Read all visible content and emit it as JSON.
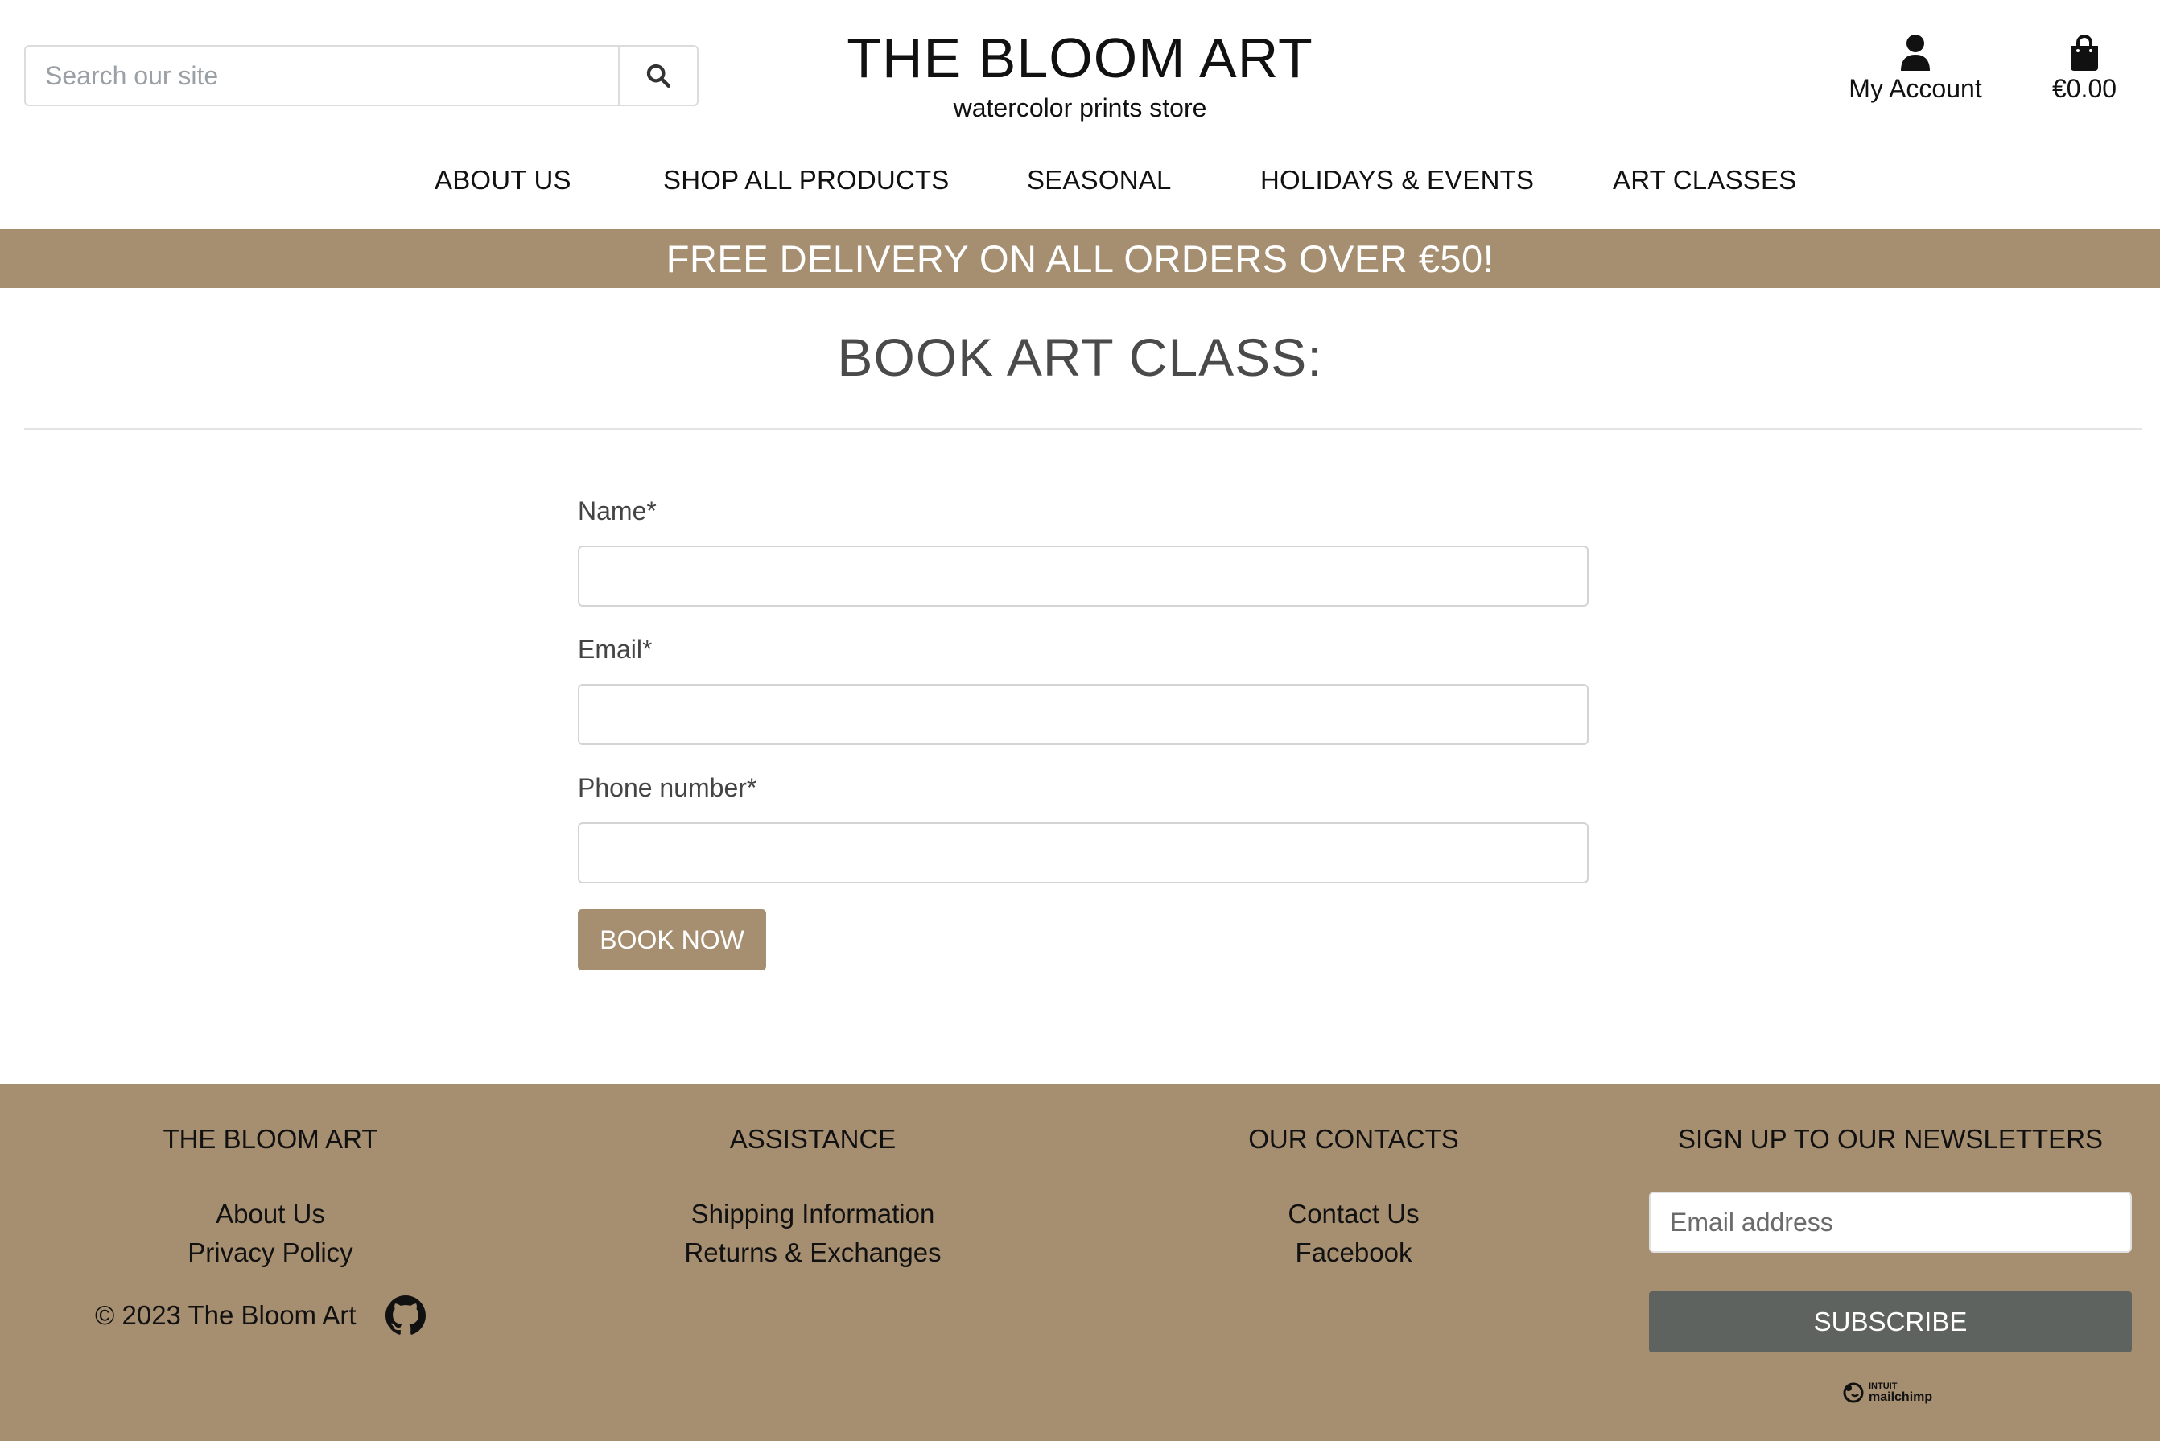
{
  "header": {
    "search_placeholder": "Search our site",
    "brand_title": "THE BLOOM ART",
    "brand_tagline": "watercolor prints store",
    "account_label": "My Account",
    "cart_total": "€0.00"
  },
  "nav": {
    "items": [
      {
        "label": "ABOUT US"
      },
      {
        "label": "SHOP ALL PRODUCTS"
      },
      {
        "label": "SEASONAL"
      },
      {
        "label": "HOLIDAYS & EVENTS"
      },
      {
        "label": "ART CLASSES"
      }
    ]
  },
  "banner": {
    "text": "FREE DELIVERY ON ALL ORDERS OVER €50!"
  },
  "page": {
    "title": "BOOK ART CLASS:"
  },
  "form": {
    "name_label": "Name*",
    "name_value": "",
    "email_label": "Email*",
    "email_value": "",
    "phone_label": "Phone number*",
    "phone_value": "",
    "submit_label": "BOOK NOW"
  },
  "footer": {
    "col1": {
      "heading": "THE BLOOM ART",
      "links": [
        "About Us",
        "Privacy Policy"
      ]
    },
    "col2": {
      "heading": "ASSISTANCE",
      "links": [
        "Shipping Information",
        "Returns & Exchanges"
      ]
    },
    "col3": {
      "heading": "OUR CONTACTS",
      "links": [
        "Contact Us",
        "Facebook"
      ]
    },
    "col4": {
      "heading": "SIGN UP TO OUR NEWSLETTERS"
    },
    "copyright": "© 2023 The Bloom Art",
    "newsletter_placeholder": "Email address",
    "subscribe_label": "SUBSCRIBE",
    "mailchimp_small": "INTUIT",
    "mailchimp_big": "mailchimp"
  },
  "icons": {
    "search": "search-icon",
    "account": "user-icon",
    "cart": "shopping-bag-icon",
    "github": "github-icon",
    "mailchimp": "mailchimp-logo-icon"
  },
  "colors": {
    "accent": "#a68e70",
    "subscribe": "#5f635f",
    "title": "#4a4a4a"
  }
}
